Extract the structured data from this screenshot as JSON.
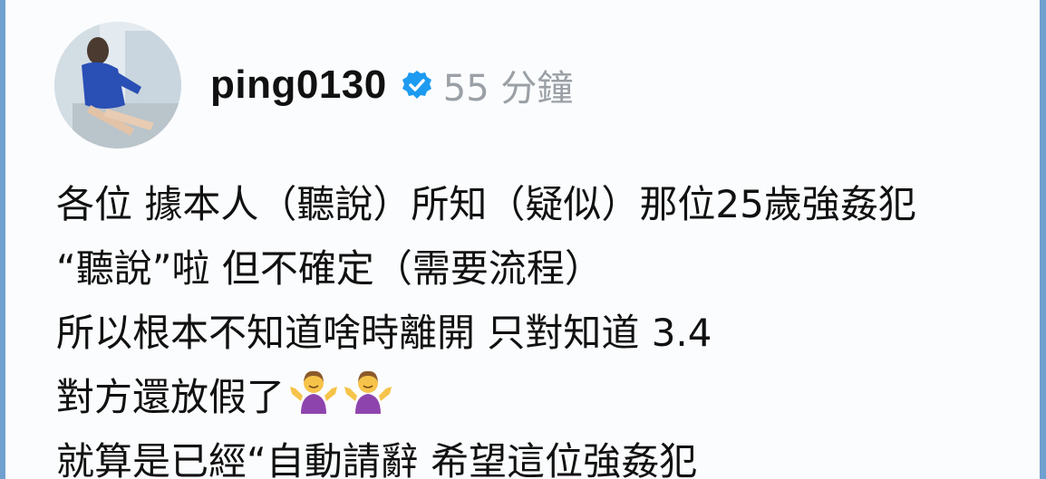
{
  "post": {
    "username": "ping0130",
    "time_ago": "55 分鐘",
    "lines": [
      "各位 據本人（聽說）所知（疑似）那位25歲強姦犯",
      "“聽說”啦 但不確定（需要流程）",
      "所以根本不知道啥時離開 只對知道 3.4",
      "對方還放假了",
      "就算是已經“自動請辭 希望這位強姦犯"
    ],
    "icons": {
      "verified": "verified-badge-icon",
      "emoji": "person-shrugging-emoji"
    },
    "colors": {
      "border": "#6fa0cf",
      "verified": "#1d9bf0",
      "emoji": "#8e44ad"
    }
  }
}
